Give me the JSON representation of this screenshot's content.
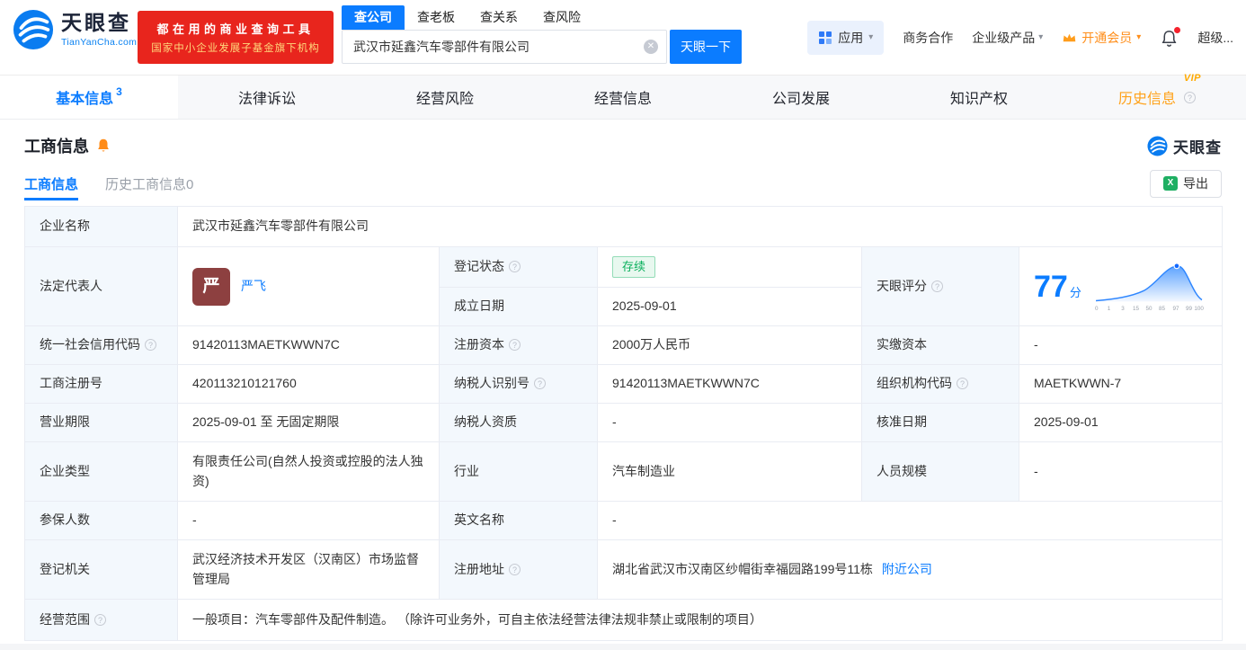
{
  "colors": {
    "accent": "#0b7cff",
    "promo_red": "#e8251d",
    "status_green": "#0ab05c",
    "vip_orange": "#ffa21a"
  },
  "header": {
    "logo_brand": "天眼查",
    "logo_domain": "TianYanCha.com",
    "promo_line1": "都在用的商业查询工具",
    "promo_line2": "国家中小企业发展子基金旗下机构",
    "search_tabs": [
      "查公司",
      "查老板",
      "查关系",
      "查风险"
    ],
    "search_value": "武汉市延鑫汽车零部件有限公司",
    "search_button": "天眼一下",
    "apps_label": "应用",
    "biz_coop": "商务合作",
    "enterprise_products": "企业级产品",
    "vip_upgrade": "开通会员",
    "super_label": "超级..."
  },
  "nav": {
    "tabs": [
      {
        "label": "基本信息",
        "badge": "3"
      },
      {
        "label": "法律诉讼"
      },
      {
        "label": "经营风险"
      },
      {
        "label": "经营信息"
      },
      {
        "label": "公司发展"
      },
      {
        "label": "知识产权"
      },
      {
        "label": "历史信息",
        "tag": "VIP"
      }
    ]
  },
  "section": {
    "title": "工商信息",
    "brand": "天眼查"
  },
  "subtabs": {
    "current": "工商信息",
    "history": "历史工商信息0",
    "export_label": "导出"
  },
  "info": {
    "company_name": {
      "label": "企业名称",
      "value": "武汉市延鑫汽车零部件有限公司"
    },
    "legal_rep": {
      "label": "法定代表人",
      "avatar": "严",
      "value": "严飞"
    },
    "reg_status": {
      "label": "登记状态",
      "value": "存续"
    },
    "establish_date": {
      "label": "成立日期",
      "value": "2025-09-01"
    },
    "score": {
      "label": "天眼评分",
      "value": "77",
      "unit": "分"
    },
    "credit_code": {
      "label": "统一社会信用代码",
      "value": "91420113MAETKWWN7C"
    },
    "reg_capital": {
      "label": "注册资本",
      "value": "2000万人民币"
    },
    "paid_capital": {
      "label": "实缴资本",
      "value": "-"
    },
    "reg_number": {
      "label": "工商注册号",
      "value": "420113210121760"
    },
    "taxpayer_id": {
      "label": "纳税人识别号",
      "value": "91420113MAETKWWN7C"
    },
    "org_code": {
      "label": "组织机构代码",
      "value": "MAETKWWN-7"
    },
    "business_term": {
      "label": "营业期限",
      "value": "2025-09-01 至 无固定期限"
    },
    "taxpayer_quality": {
      "label": "纳税人资质",
      "value": "-"
    },
    "approval_date": {
      "label": "核准日期",
      "value": "2025-09-01"
    },
    "company_type": {
      "label": "企业类型",
      "value": "有限责任公司(自然人投资或控股的法人独资)"
    },
    "industry": {
      "label": "行业",
      "value": "汽车制造业"
    },
    "staff_size": {
      "label": "人员规模",
      "value": "-"
    },
    "insured_count": {
      "label": "参保人数",
      "value": "-"
    },
    "english_name": {
      "label": "英文名称",
      "value": "-"
    },
    "reg_authority": {
      "label": "登记机关",
      "value": "武汉经济技术开发区（汉南区）市场监督管理局"
    },
    "reg_address": {
      "label": "注册地址",
      "value": "湖北省武汉市汉南区纱帽街幸福园路199号11栋",
      "link": "附近公司"
    },
    "business_scope": {
      "label": "经营范围",
      "value": "一般项目：汽车零部件及配件制造。 （除许可业务外，可自主依法经营法律法规非禁止或限制的项目）"
    }
  },
  "score_chart": {
    "type": "area",
    "x_ticks": [
      "0",
      "1",
      "3",
      "15",
      "50",
      "85",
      "97",
      "99",
      "100"
    ],
    "score": 77
  }
}
